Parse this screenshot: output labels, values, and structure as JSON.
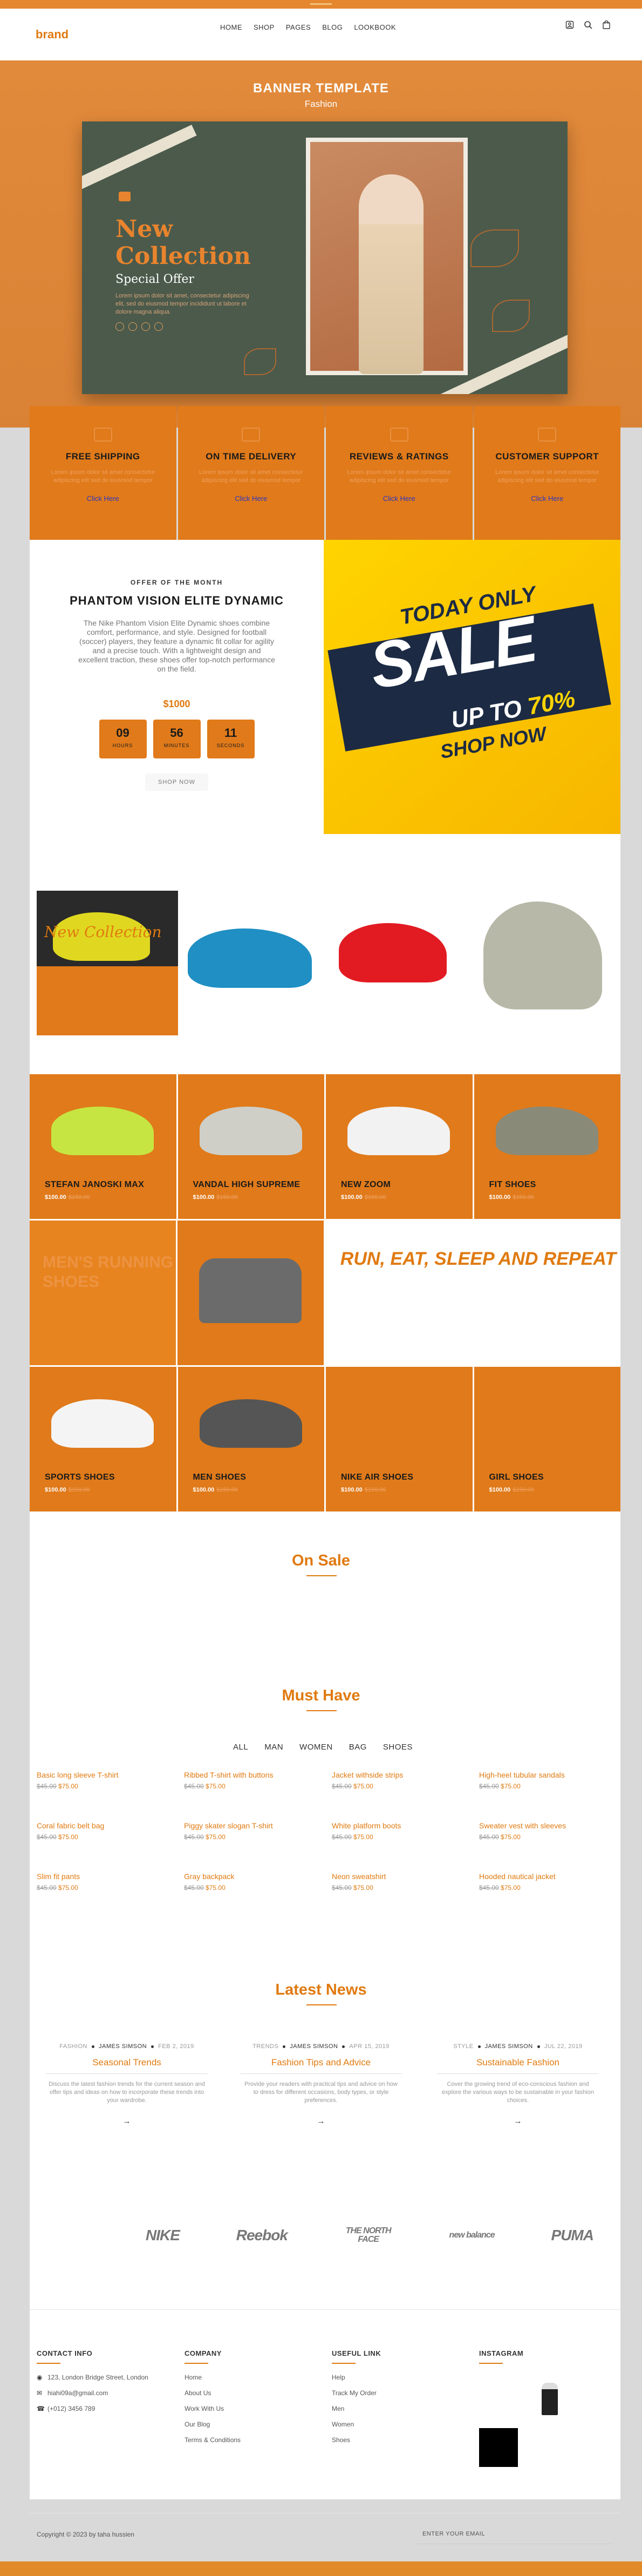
{
  "header": {
    "brand": "brand",
    "nav": [
      "HOME",
      "SHOP",
      "PAGES",
      "BLOG",
      "LOOKBOOK"
    ],
    "icons": [
      "user-icon",
      "search-icon",
      "bag-icon"
    ]
  },
  "banner": {
    "title": "BANNER TEMPLATE",
    "subtitle": "Fashion",
    "heading": "New Collection",
    "special": "Special Offer",
    "lorem": "Lorem ipsum dolor sit amet, consectetur adipiscing elit, sed do eiusmod tempor incididunt ut labore et dolore magna aliqua."
  },
  "features": [
    {
      "title": "FREE SHIPPING",
      "text": "Lorem ipsum dolor sit amet consectetur adipiscing elit sed do eiusmod tempor",
      "link": "Click Here"
    },
    {
      "title": "ON TIME DELIVERY",
      "text": "Lorem ipsum dolor sit amet consectetur adipiscing elit sed do eiusmod tempor",
      "link": "Click Here"
    },
    {
      "title": "REVIEWS & RATINGS",
      "text": "Lorem ipsum dolor sit amet consectetur adipiscing elit sed do eiusmod tempor",
      "link": "Click Here"
    },
    {
      "title": "CUSTOMER SUPPORT",
      "text": "Lorem ipsum dolor sit amet consectetur adipiscing elit sed do eiusmod tempor",
      "link": "Click Here"
    }
  ],
  "offer": {
    "label": "OFFER OF THE MONTH",
    "title": "PHANTOM VISION ELITE DYNAMIC",
    "desc": "The Nike Phantom Vision Elite Dynamic shoes combine comfort, performance, and style. Designed for football (soccer) players, they feature a dynamic fit collar for agility and a precise touch. With a lightweight design and excellent traction, these shoes offer top-notch performance on the field.",
    "price": "$1000",
    "countdown": [
      {
        "value": "09",
        "unit": "HOURS"
      },
      {
        "value": "56",
        "unit": "MINUTES"
      },
      {
        "value": "11",
        "unit": "SECONDS"
      }
    ],
    "button": "SHOP NOW"
  },
  "sale": {
    "today": "TODAY ONLY",
    "sale": "SALE",
    "upto": "UP TO",
    "pct": "70%",
    "shop": "SHOP NOW"
  },
  "gallery_text": "New Collection",
  "products": [
    {
      "name": "STEFAN JANOSKI MAX",
      "price": "$100.00",
      "old": "$150.00",
      "color": "#c6e542"
    },
    {
      "name": "VANDAL HIGH SUPREME",
      "price": "$100.00",
      "old": "$150.00",
      "color": "#cfcfc8"
    },
    {
      "name": "NEW ZOOM",
      "price": "$100.00",
      "old": "$150.00",
      "color": "#f2f2f2"
    },
    {
      "name": "FIT SHOES",
      "price": "$100.00",
      "old": "$150.00",
      "color": "#8a8a78"
    },
    {
      "name": "SPORTS SHOES",
      "price": "$100.00",
      "old": "$150.00",
      "color": "#f4f4f4"
    },
    {
      "name": "MEN SHOES",
      "price": "$100.00",
      "old": "$150.00",
      "color": "#555"
    },
    {
      "name": "NIKE AIR SHOES",
      "price": "$100.00",
      "old": "$150.00",
      "color": ""
    },
    {
      "name": "GIRL SHOES",
      "price": "$100.00",
      "old": "$150.00",
      "color": ""
    }
  ],
  "men_running": "MEN'S RUNNING SHOES",
  "run_text": "RUN, EAT, SLEEP AND REPEAT",
  "onsale": "On Sale",
  "musthave": {
    "title": "Must Have",
    "filters": [
      "ALL",
      "MAN",
      "WOMEN",
      "BAG",
      "SHOES"
    ],
    "items": [
      {
        "name": "Basic long sleeve T-shirt",
        "old": "$45.00",
        "new": "$75.00"
      },
      {
        "name": "Ribbed T-shirt with buttons",
        "old": "$45.00",
        "new": "$75.00"
      },
      {
        "name": "Jacket withside strips",
        "old": "$45.00",
        "new": "$75.00"
      },
      {
        "name": "High-heel tubular sandals",
        "old": "$45.00",
        "new": "$75.00"
      },
      {
        "name": "Coral fabric belt bag",
        "old": "$45.00",
        "new": "$75.00"
      },
      {
        "name": "Piggy skater slogan T-shirt",
        "old": "$45.00",
        "new": "$75.00"
      },
      {
        "name": "White platform boots",
        "old": "$45.00",
        "new": "$75.00"
      },
      {
        "name": "Sweater vest with sleeves",
        "old": "$45.00",
        "new": "$75.00"
      },
      {
        "name": "Slim fit pants",
        "old": "$45.00",
        "new": "$75.00"
      },
      {
        "name": "Gray backpack",
        "old": "$45.00",
        "new": "$75.00"
      },
      {
        "name": "Neon sweatshirt",
        "old": "$45.00",
        "new": "$75.00"
      },
      {
        "name": "Hooded nautical jacket",
        "old": "$45.00",
        "new": "$75.00"
      }
    ]
  },
  "latest": {
    "title": "Latest News",
    "posts": [
      {
        "cat": "FASHION",
        "author": "JAMES SIMSON",
        "date": "FEB 2, 2019",
        "title": "Seasonal Trends",
        "text": "Discuss the latest fashion trends for the current season and offer tips and ideas on how to incorporate these trends into your wardrobe.",
        "arrow": "→"
      },
      {
        "cat": "TRENDS",
        "author": "JAMES SIMSON",
        "date": "APR 15, 2019",
        "title": "Fashion Tips and Advice",
        "text": "Provide your readers with practical tips and advice on how to dress for different occasions, body types, or style preferences.",
        "arrow": "→"
      },
      {
        "cat": "STYLE",
        "author": "JAMES SIMSON",
        "date": "JUL 22, 2019",
        "title": "Sustainable Fashion",
        "text": "Cover the growing trend of eco-conscious fashion and explore the various ways to be sustainable in your fashion choices.",
        "arrow": "→"
      }
    ]
  },
  "brands": [
    "NIKE",
    "Reebok",
    "THE NORTH FACE",
    "new balance",
    "PUMA"
  ],
  "footer": {
    "contact": {
      "title": "CONTACT INFO",
      "address": "123, London Bridge Street, London",
      "email": "hiahi09a@gmail.com",
      "phone": "(+012) 3456 789"
    },
    "company": {
      "title": "COMPANY",
      "links": [
        "Home",
        "About Us",
        "Work With Us",
        "Our Blog",
        "Terms & Conditions"
      ]
    },
    "useful": {
      "title": "USEFUL LINK",
      "links": [
        "Help",
        "Track My Order",
        "Men",
        "Women",
        "Shoes"
      ]
    },
    "instagram": {
      "title": "INSTAGRAM"
    },
    "copyright": "Copyright © 2023 by taha hussien",
    "email_placeholder": "ENTER YOUR EMAIL"
  }
}
